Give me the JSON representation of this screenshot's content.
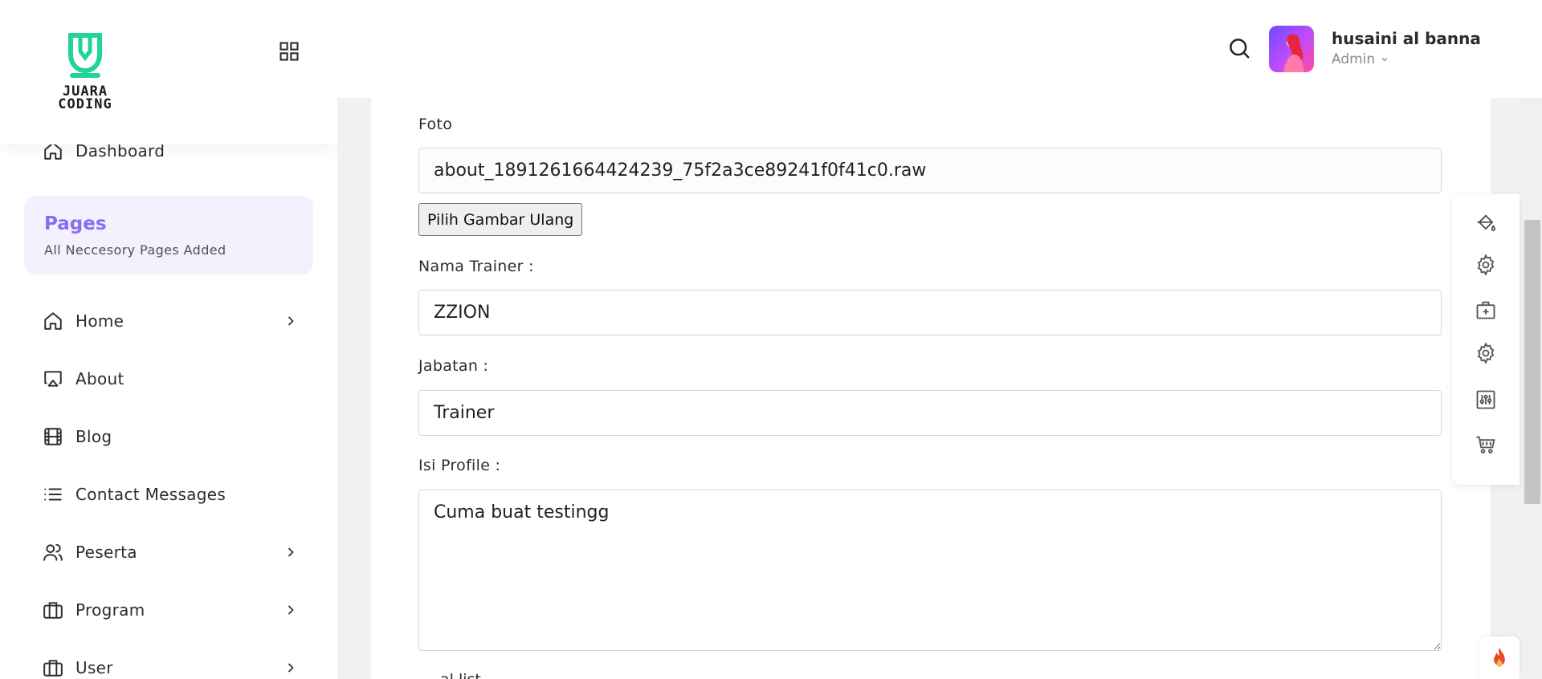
{
  "brand": {
    "logo_text": "JUARA\nCODING",
    "accent": "#22d39b"
  },
  "sidebar": {
    "dashboard": "Dashboard",
    "pages_card": {
      "title": "Pages",
      "subtitle": "All Neccesory Pages Added"
    },
    "items": [
      {
        "label": "Home",
        "icon": "home-icon",
        "has_submenu": true
      },
      {
        "label": "About",
        "icon": "monitor-icon",
        "has_submenu": false
      },
      {
        "label": "Blog",
        "icon": "film-icon",
        "has_submenu": false
      },
      {
        "label": "Contact Messages",
        "icon": "list-icon",
        "has_submenu": false
      },
      {
        "label": "Peserta",
        "icon": "users-icon",
        "has_submenu": true
      },
      {
        "label": "Program",
        "icon": "briefcase-icon",
        "has_submenu": true
      },
      {
        "label": "User",
        "icon": "briefcase-icon",
        "has_submenu": true
      }
    ]
  },
  "header": {
    "user_name": "husaini al banna",
    "user_role": "Admin"
  },
  "form": {
    "foto_label": "Foto",
    "foto_value": "about_1891261664424239_75f2a3ce89241f0f41c0.raw",
    "pick_button": "Pilih Gambar Ulang",
    "trainer_label": "Nama Trainer :",
    "trainer_value": "ZZION",
    "jabatan_label": "Jabatan :",
    "jabatan_value": "Trainer",
    "profile_label": "Isi Profile :",
    "profile_value": "Cuma buat testingg",
    "next_label_partial": "al list"
  },
  "colors": {
    "purple": "#8a6cf0",
    "fire": "#e8492a"
  }
}
